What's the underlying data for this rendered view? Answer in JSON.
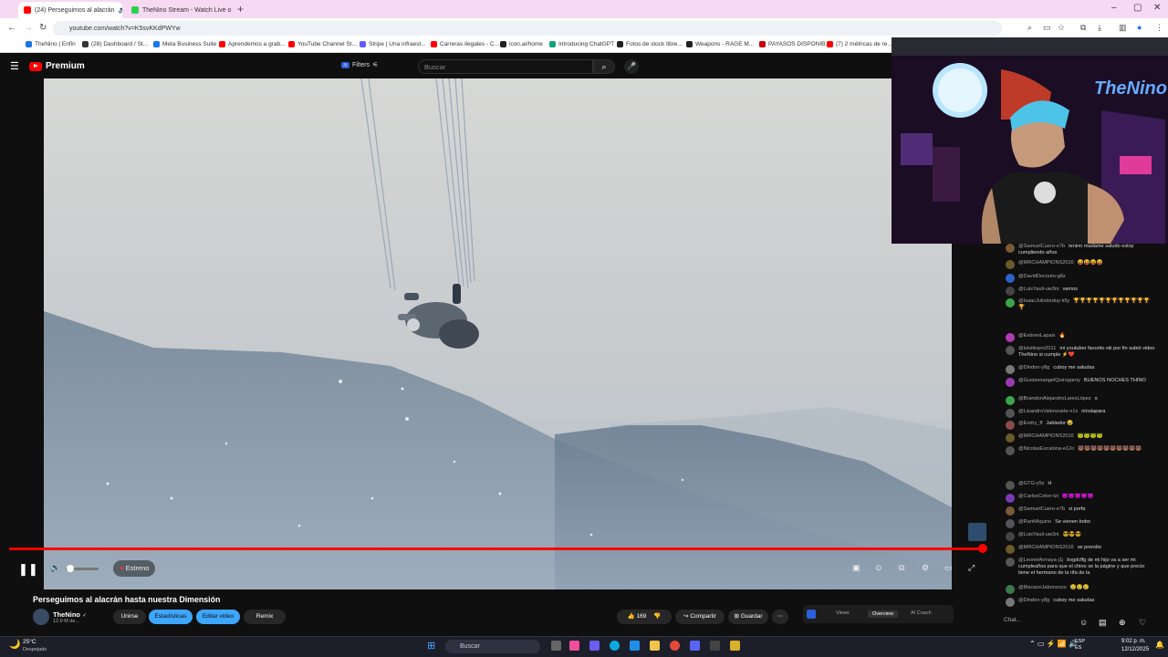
{
  "browser": {
    "tabs": [
      {
        "label": "(24) Perseguimos al alacrán",
        "active": true
      },
      {
        "label": "TheNino Stream - Watch Live o",
        "active": false
      }
    ],
    "url": "youtube.com/watch?v=K5svKKdPWYw",
    "bookmarks": [
      "TheNino | Enfin",
      "(28) Dashboard / St...",
      "Meta Business Suite",
      "Aprendemos a grab...",
      "YouTube Channel St...",
      "Stripe | Una infraest...",
      "Carreras ilegales - C...",
      "icon.ai/home",
      "Introducing ChatGPT",
      "Fotos de stock libre...",
      "Weapons - RAGE M...",
      "PAYASOS DISPONIB...",
      "(7) 2 métricas de re..."
    ]
  },
  "youtube": {
    "brand": "Premium",
    "filters_label": "Filters",
    "search_placeholder": "Buscar"
  },
  "player": {
    "estreno_label": "Estreno",
    "progress": 0.995,
    "volume": 0.15
  },
  "video_info": {
    "title": "Perseguimos al alacrán hasta nuestra Dimensión",
    "channel": "TheNino",
    "subscribers": "12.9 M de...",
    "join_label": "Unirse",
    "stats_label": "Estadísticas",
    "edit_label": "Editar video",
    "remix_label": "Remix",
    "likes": "169",
    "share_label": "Compartir",
    "save_label": "Guardar",
    "tabs": [
      "Views",
      "Overview",
      "AI Coach"
    ]
  },
  "chat": {
    "messages": [
      {
        "user": "@SamuelCuero-e7b",
        "text": "tenino madame saludo estoy cumpliendo años",
        "color": "#7a5a3a"
      },
      {
        "user": "@MRCHAMPIONS2016",
        "text": "😝😝😝😝",
        "color": "#6b5a2a"
      },
      {
        "user": "@DavidDocouto-g8z",
        "text": "",
        "color": "#2b63c8"
      },
      {
        "user": "@LuisYauli-uw3ni",
        "text": "vamos",
        "color": "#444"
      },
      {
        "user": "@IsaacJuliolorduy-k5y",
        "text": "🏆🏆🏆🏆🏆🏆🏆🏆🏆🏆🏆🏆🏆",
        "color": "#3aa54a"
      },
      {
        "user": "@EstivenLapaix",
        "text": "🔥",
        "color": "#b23ab5"
      },
      {
        "user": "@luisitinpro2011",
        "text": "mi youtuber favorito siii por fin subió video TheNino si cumple ⚡❤️",
        "color": "#555"
      },
      {
        "user": "@Dindon-y8g",
        "text": "cuboy me saludas",
        "color": "#777"
      },
      {
        "user": "@GustavoangelQuirogaroy",
        "text": "BUENOS NOCHES THINO",
        "color": "#9a3ab5"
      },
      {
        "user": "@BrandonAlejandroLaresLópez",
        "text": "s",
        "color": "#3aa54a"
      },
      {
        "user": "@LisandroValenzuela-n1x",
        "text": "ninolapara",
        "color": "#555"
      },
      {
        "user": "@Endry_ff",
        "text": "Jablador 😂",
        "color": "#8a4a4a"
      },
      {
        "user": "@MRCHAMPIONS2016",
        "text": "🐸🐸🐸🐸",
        "color": "#6b5a2a"
      },
      {
        "user": "@NicolasEscalona-e12o",
        "text": "🐻🐻🐻🐻🐻🐻🐻🐻🐻🐻",
        "color": "#555"
      },
      {
        "user": "@GTG-y5z",
        "text": "H",
        "color": "#555"
      },
      {
        "user": "@CarlosColon-tzi",
        "text": "😈😈😈😈😈",
        "color": "#7a3ab5"
      },
      {
        "user": "@SamuelCuero-e7b",
        "text": "si porfa",
        "color": "#7a5a3a"
      },
      {
        "user": "@RanfiAquino",
        "text": "Se vienen bobo",
        "color": "#555"
      },
      {
        "user": "@LuisYauli-uw3ni",
        "text": "😎😎😎",
        "color": "#444"
      },
      {
        "user": "@MRCHAMPIONS2016",
        "text": "se prendio",
        "color": "#6b5a2a"
      },
      {
        "user": "@LeonelArmaya-j1j",
        "text": "bvgdcffg de mi hijo va a ser mi cumpleaños para que el chino se la págine y que precio tiene el hermano de la rifa de la",
        "color": "#555"
      },
      {
        "user": "@MacaonJabonzoco",
        "text": "😢😢😢",
        "color": "#3a7a4a"
      },
      {
        "user": "@Dindon-y8g",
        "text": "cuboy me saludas",
        "color": "#777"
      }
    ],
    "input_placeholder": "Chat..."
  },
  "taskbar": {
    "temperature": "25°C",
    "weather": "Despejado",
    "search_placeholder": "Buscar",
    "language": "ESP\nES",
    "time": "9:02 p. m.",
    "date": "12/12/2025"
  }
}
